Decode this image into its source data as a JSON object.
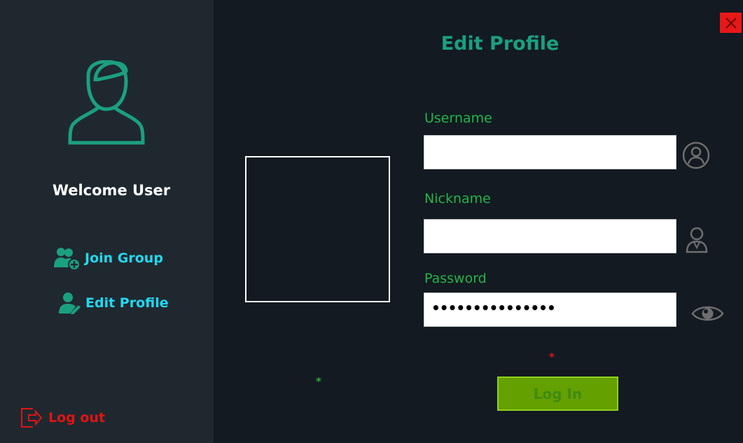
{
  "sidebar": {
    "welcome": "Welcome User",
    "nav": [
      {
        "label": "Join Group",
        "icon": "add-user-group-icon"
      },
      {
        "label": "Edit Profile",
        "icon": "edit-user-icon"
      }
    ],
    "logout_label": "Log out",
    "avatar_icon": "user-avatar-icon"
  },
  "main": {
    "title": "Edit Profile",
    "fields": {
      "username": {
        "label": "Username",
        "value": "",
        "icon": "user-circle-icon"
      },
      "nickname": {
        "label": "Nickname",
        "value": "",
        "icon": "person-icon"
      },
      "password": {
        "label": "Password",
        "value": "•••••••••••••••",
        "icon": "eye-icon"
      }
    },
    "asterisk_left": "*",
    "asterisk_right": "*",
    "login_button": "Log In"
  },
  "colors": {
    "sidebar_bg": "#1f282f",
    "main_bg": "#131a21",
    "accent_teal": "#1ba07f",
    "nav_cyan": "#22d8f0",
    "label_green": "#21b54a",
    "logout_red": "#e01414",
    "button_green": "#63a000"
  }
}
